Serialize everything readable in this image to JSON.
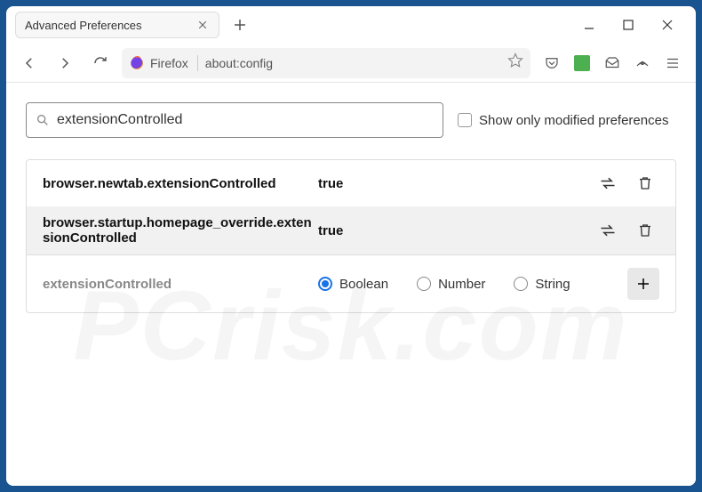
{
  "tab": {
    "title": "Advanced Preferences"
  },
  "url": {
    "identity": "Firefox",
    "text": "about:config"
  },
  "search": {
    "value": "extensionControlled",
    "placeholder": ""
  },
  "show_modified": {
    "label": "Show only modified preferences",
    "checked": false
  },
  "prefs": [
    {
      "name": "browser.newtab.extensionControlled",
      "value": "true"
    },
    {
      "name": "browser.startup.homepage_override.extensionControlled",
      "value": "true"
    }
  ],
  "add_row": {
    "name": "extensionControlled",
    "types": [
      {
        "label": "Boolean",
        "selected": true
      },
      {
        "label": "Number",
        "selected": false
      },
      {
        "label": "String",
        "selected": false
      }
    ]
  },
  "watermark": "PCrisk.com"
}
